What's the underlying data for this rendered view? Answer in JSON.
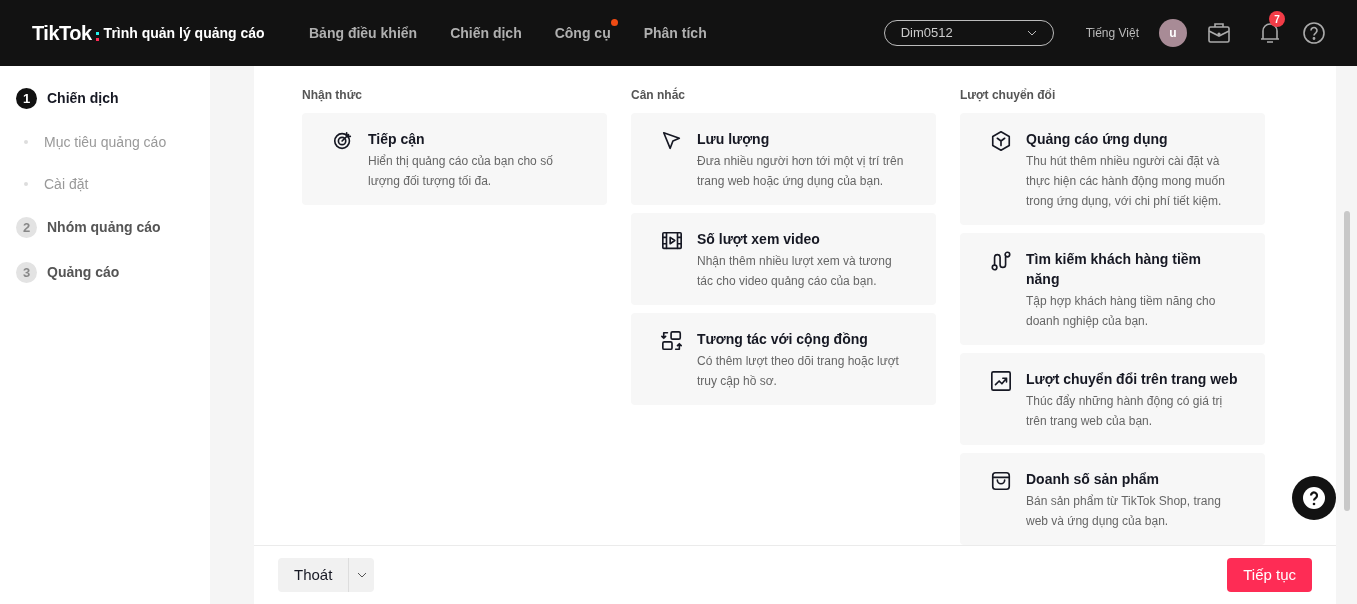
{
  "header": {
    "logo": "TikTok",
    "app_name": "Trình quản lý quảng cáo",
    "nav": [
      {
        "label": "Bảng điều khiển",
        "dot": false
      },
      {
        "label": "Chiến dịch",
        "dot": false
      },
      {
        "label": "Công cụ",
        "dot": true
      },
      {
        "label": "Phân tích",
        "dot": false
      }
    ],
    "account": "Dim0512",
    "language": "Tiếng Việt",
    "avatar": "u",
    "notification_count": "7"
  },
  "sidebar": [
    {
      "kind": "step",
      "number": "1",
      "label": "Chiến dịch",
      "selected": true
    },
    {
      "kind": "sub",
      "label": "Mục tiêu quảng cáo"
    },
    {
      "kind": "sub",
      "label": "Cài đặt"
    },
    {
      "kind": "step",
      "number": "2",
      "label": "Nhóm quảng cáo",
      "selected": false
    },
    {
      "kind": "step",
      "number": "3",
      "label": "Quảng cáo",
      "selected": false
    }
  ],
  "columns": [
    {
      "heading": "Nhận thức",
      "objectives": [
        {
          "title": "Tiếp cận",
          "description": "Hiển thị quảng cáo của bạn cho số lượng đối tượng tối đa."
        }
      ]
    },
    {
      "heading": "Cân nhắc",
      "objectives": [
        {
          "title": "Lưu lượng",
          "description": "Đưa nhiều người hơn tới một vị trí trên trang web hoặc ứng dụng của bạn."
        },
        {
          "title": "Số lượt xem video",
          "description": "Nhận thêm nhiều lượt xem và tương tác cho video quảng cáo của bạn."
        },
        {
          "title": "Tương tác với cộng đồng",
          "description": "Có thêm lượt theo dõi trang hoặc lượt truy cập hồ sơ."
        }
      ]
    },
    {
      "heading": "Lượt chuyển đổi",
      "objectives": [
        {
          "title": "Quảng cáo ứng dụng",
          "description": "Thu hút thêm nhiều người cài đặt và thực hiện các hành động mong muốn trong ứng dụng, với chi phí tiết kiệm."
        },
        {
          "title": "Tìm kiếm khách hàng tiềm năng",
          "description": "Tập hợp khách hàng tiềm năng cho doanh nghiệp của bạn."
        },
        {
          "title": "Lượt chuyển đổi trên trang web",
          "description": "Thúc đẩy những hành động có giá trị trên trang web của bạn."
        },
        {
          "title": "Doanh số sản phẩm",
          "description": "Bán sản phẩm từ TikTok Shop, trang web và ứng dụng của bạn."
        }
      ]
    }
  ],
  "footer": {
    "exit_button": "Thoát",
    "continue_button": "Tiếp tục"
  }
}
